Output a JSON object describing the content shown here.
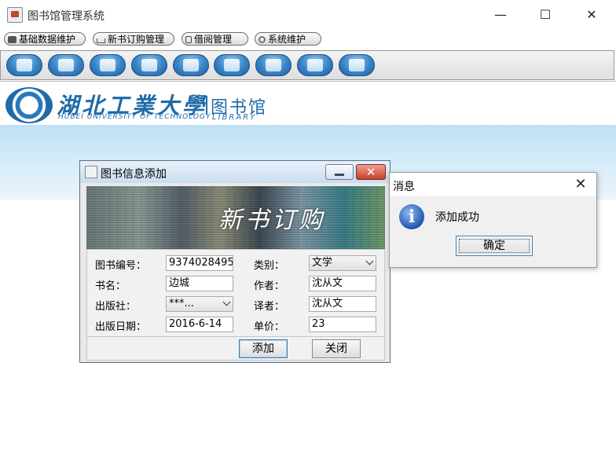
{
  "window": {
    "title": "图书馆管理系统",
    "minimize": "—",
    "maximize": "☐",
    "close": "✕"
  },
  "menu": [
    {
      "label": "基础数据维护",
      "icon": "cube-icon"
    },
    {
      "label": "新书订购管理",
      "icon": "cart-icon"
    },
    {
      "label": "借阅管理",
      "icon": "lock-icon"
    },
    {
      "label": "系统维护",
      "icon": "gears-icon"
    }
  ],
  "toolbar": [
    {
      "icon": "book-icon"
    },
    {
      "icon": "pen-icon"
    },
    {
      "icon": "books-icon"
    },
    {
      "icon": "person-icon"
    },
    {
      "icon": "box-icon"
    },
    {
      "icon": "search-icon"
    },
    {
      "icon": "screen-icon"
    },
    {
      "icon": "note-icon"
    },
    {
      "icon": "exit-icon"
    }
  ],
  "banner": {
    "school_zh": "湖北工業大學",
    "school_en": "HUBEI UNIVERSITY OF TECHNOLOGY",
    "library_zh": "图书馆",
    "library_en": "LIBRARY"
  },
  "book_dialog": {
    "title": "图书信息添加",
    "banner_caption": "新书订购",
    "close_glyph": "✕",
    "labels": {
      "isbn": "图书编号：",
      "category": "类别：",
      "name": "书名：",
      "author": "作者：",
      "publisher": "出版社：",
      "translator": "译者：",
      "date": "出版日期：",
      "price": "单价："
    },
    "values": {
      "isbn": "9374028495",
      "category": "文学",
      "name": "边城",
      "author": "沈从文",
      "publisher": "***...",
      "translator": "沈从文",
      "date": "2016-6-14",
      "price": "23"
    },
    "buttons": {
      "add": "添加",
      "close": "关闭"
    }
  },
  "message_dialog": {
    "title": "消息",
    "close_glyph": "✕",
    "icon_glyph": "i",
    "text": "添加成功",
    "ok": "确定"
  }
}
